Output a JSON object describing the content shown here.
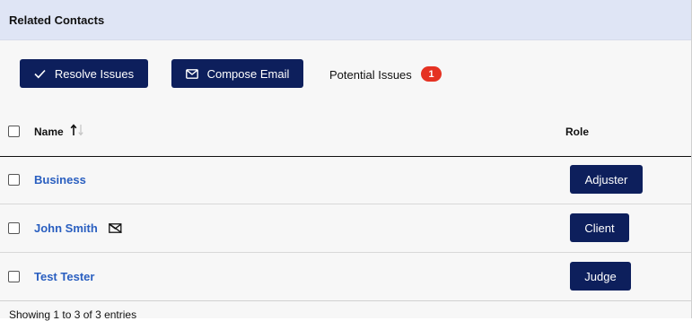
{
  "header": {
    "title": "Related Contacts"
  },
  "toolbar": {
    "resolve_label": "Resolve Issues",
    "compose_label": "Compose Email",
    "issues_label": "Potential Issues",
    "issues_count": "1"
  },
  "table": {
    "columns": {
      "name": "Name",
      "role": "Role"
    },
    "rows": [
      {
        "name": "Business",
        "role": "Adjuster",
        "no_email": false
      },
      {
        "name": "John Smith",
        "role": "Client",
        "no_email": true
      },
      {
        "name": "Test Tester",
        "role": "Judge",
        "no_email": false
      }
    ]
  },
  "footer": {
    "text": "Showing 1 to 3 of 3 entries"
  },
  "colors": {
    "header_bg": "#dfe5f5",
    "button_bg": "#0d1f5c",
    "link": "#2a5fc0",
    "badge": "#e53222"
  },
  "icons": {
    "resolve": "check-icon",
    "compose": "envelope-icon",
    "sort": "sort-ascending-icon",
    "row_email": "no-email-icon"
  }
}
